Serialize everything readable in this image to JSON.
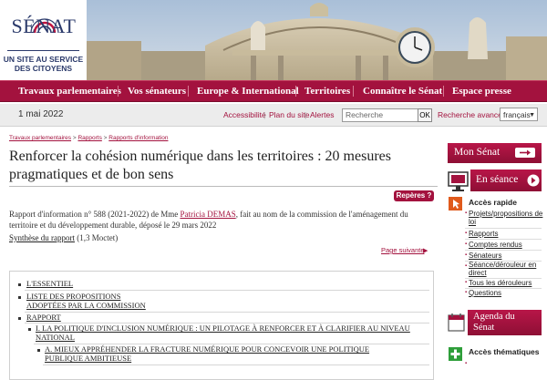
{
  "header": {
    "logo_name": "SÉNAT",
    "logo_subtitle_line1": "UN SITE AU SERVICE",
    "logo_subtitle_line2": "DES CITOYENS"
  },
  "nav": {
    "items": [
      "Travaux parlementaires",
      "Vos sénateurs",
      "Europe & International",
      "Territoires",
      "Connaître le Sénat",
      "Espace presse"
    ]
  },
  "util": {
    "date": "1 mai 2022",
    "accessibilite": "Accessibilité",
    "plan": "Plan du site",
    "alertes": "Alertes",
    "search_placeholder": "Recherche",
    "ok": "OK",
    "advanced": "Recherche avancée",
    "language": "français"
  },
  "breadcrumb": {
    "items": [
      "Travaux parlementaires",
      "Rapports",
      "Rapports d'information"
    ],
    "sep": ">"
  },
  "main": {
    "title": "Renforcer la cohésion numérique dans les territoires : 20 mesures pragmatiques et de bon sens",
    "reperes": "Repères ?",
    "report_prefix": "Rapport d'information n° 588 (2021-2022) de Mme ",
    "report_author": "Patricia DEMAS",
    "report_suffix": ", fait au nom de la commission de l'aménagement du territoire et du développement durable, déposé le 29 mars 2022",
    "synthese_link": "Synthèse du rapport",
    "synthese_size": " (1,3 Moctet)",
    "page_suivante": "Page suivante"
  },
  "toc": {
    "items": [
      {
        "line1": "L'ESSENTIEL",
        "line2": ""
      },
      {
        "line1": "LISTE DES PROPOSITIONS",
        "line2": "ADOPTÉES PAR LA COMMISSION"
      },
      {
        "line1": "RAPPORT",
        "line2": ""
      },
      {
        "line1": "I. LA POLITIQUE D'INCLUSION NUMÉRIQUE : UN PILOTAGE À RENFORCER ET À CLARIFIER AU NIVEAU",
        "line2": "NATIONAL"
      },
      {
        "line1": "A. MIEUX APPRÉHENDER LA FRACTURE NUMÉRIQUE POUR CONCEVOIR UNE POLITIQUE",
        "line2": "PUBLIQUE AMBITIEUSE"
      }
    ]
  },
  "sidebar": {
    "mon_senat": "Mon Sénat",
    "en_seance": "En séance",
    "acces_rapide": "Accès rapide",
    "links": [
      {
        "line1": "Projets/propositions de",
        "line2": "loi"
      },
      {
        "line1": "Rapports",
        "line2": ""
      },
      {
        "line1": "Comptes rendus",
        "line2": ""
      },
      {
        "line1": "Sénateurs",
        "line2": ""
      },
      {
        "line1": "Séance/dérouleur en",
        "line2": "direct"
      },
      {
        "line1": "Tous les dérouleurs",
        "line2": ""
      },
      {
        "line1": "Questions",
        "line2": ""
      }
    ],
    "agenda_line1": "Agenda du",
    "agenda_line2": "Sénat",
    "acces_thematiques": "Accès thématiques"
  }
}
